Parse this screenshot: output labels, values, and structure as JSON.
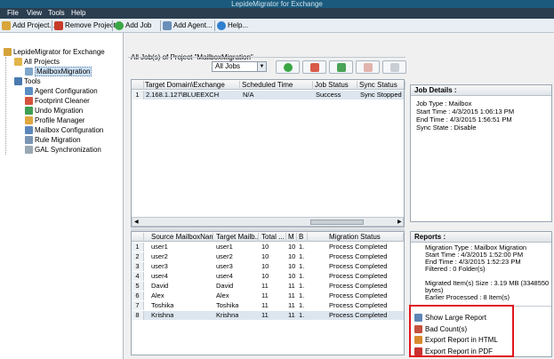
{
  "title_bar": {
    "text": "LepideMigrator for Exchange"
  },
  "menu": [
    "File",
    "View",
    "Tools",
    "Help"
  ],
  "toolbar": {
    "add_project": "Add Project...",
    "remove_project": "Remove Project",
    "add_job": "Add Job",
    "add_agent": "Add Agent...",
    "help": "Help..."
  },
  "tree": {
    "root": "LepideMigrator for Exchange",
    "all_projects": "All Projects",
    "project": "MailboxMigration",
    "tools": "Tools",
    "tool_items": [
      "Agent Configuration",
      "Footprint Cleaner",
      "Undo Migration",
      "Profile Manager",
      "Mailbox Configuration",
      "Rule Migration",
      "GAL Synchronization"
    ]
  },
  "jobs": {
    "group_title": "All Job(s)  of Project \"MailboxMigration\"",
    "filter_value": "All Jobs",
    "columns": [
      "Target Domain\\Exchange",
      "Scheduled Time",
      "Job Status",
      "Sync Status"
    ],
    "rows": [
      {
        "num": "1",
        "target": "2.168.1.127\\BLUEEXCH",
        "scheduled": "N/A",
        "status": "Success",
        "sync": "Sync Stopped"
      }
    ]
  },
  "migration": {
    "columns": [
      "Source MailboxName",
      "Target Mailb...",
      "Total ...",
      "M",
      "B",
      "Migration Status"
    ],
    "rows": [
      {
        "num": "1",
        "source": "user1",
        "target": "user1",
        "total": "10",
        "m": "10",
        "b": "1.",
        "status": "Process Completed"
      },
      {
        "num": "2",
        "source": "user2",
        "target": "user2",
        "total": "10",
        "m": "10",
        "b": "1.",
        "status": "Process Completed"
      },
      {
        "num": "3",
        "source": "user3",
        "target": "user3",
        "total": "10",
        "m": "10",
        "b": "1.",
        "status": "Process Completed"
      },
      {
        "num": "4",
        "source": "user4",
        "target": "user4",
        "total": "10",
        "m": "10",
        "b": "1.",
        "status": "Process Completed"
      },
      {
        "num": "5",
        "source": "David",
        "target": "David",
        "total": "11",
        "m": "11",
        "b": "1.",
        "status": "Process Completed"
      },
      {
        "num": "6",
        "source": "Alex",
        "target": "Alex",
        "total": "11",
        "m": "11",
        "b": "1.",
        "status": "Process Completed"
      },
      {
        "num": "7",
        "source": "Toshika",
        "target": "Toshika",
        "total": "11",
        "m": "11",
        "b": "1.",
        "status": "Process Completed"
      },
      {
        "num": "8",
        "source": "Krishna",
        "target": "Krishna",
        "total": "11",
        "m": "11",
        "b": "1.",
        "status": "Process Completed"
      }
    ]
  },
  "job_details": {
    "title": "Job Details :",
    "lines": [
      "Job Type  : Mailbox",
      "Start Time  : 4/3/2015 1:06:13 PM",
      "End Time   : 4/3/2015 1:56:51 PM",
      "Sync State : Disable"
    ]
  },
  "reports": {
    "title": "Reports :",
    "lines": [
      "Migration Type  : Mailbox Migration",
      "Start Time      : 4/3/2015 1:52:00 PM",
      "End Time       : 4/3/2015 1:52:23 PM",
      "Filtered          : 0 Folder(s)"
    ],
    "migrated_line1": "Migrated Item(s) Size   : 3.19 MB (3348550",
    "migrated_line2": "bytes)",
    "earlier_line": "Earlier Processed         : 8 Item(s)",
    "links": [
      "Show Large Report",
      "Bad Count(s)",
      "Export Report in HTML",
      "Export Report in PDF"
    ]
  },
  "colors": {
    "highlight": "#e0161e",
    "titlebar": "#1b5a7c",
    "menubar": "#2b3e50"
  }
}
